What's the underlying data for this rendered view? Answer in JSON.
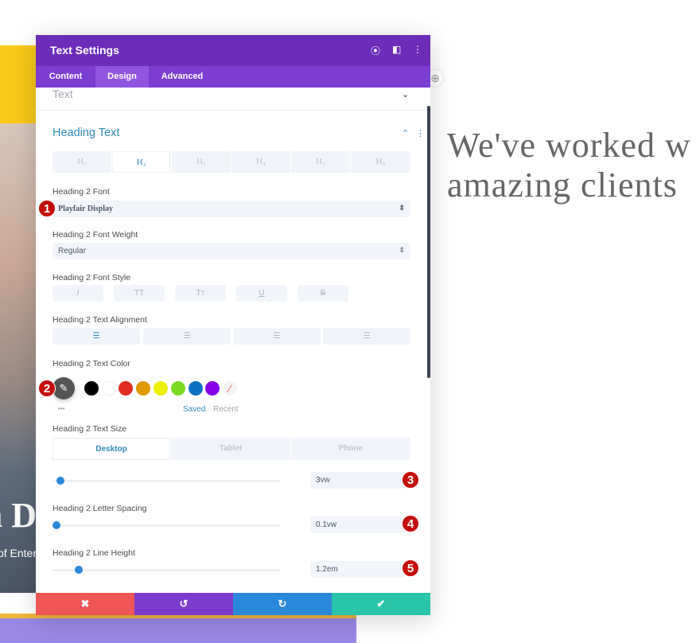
{
  "background": {
    "hero_text": "n D",
    "hero_sub": "of Enter",
    "right_heading": [
      "We've worked w",
      "amazing clients"
    ]
  },
  "panel": {
    "title": "Text Settings",
    "header_icons": [
      "focus-icon",
      "sidebar-toggle-icon",
      "more-vertical-icon"
    ],
    "tabs": [
      {
        "label": "Content"
      },
      {
        "label": "Design",
        "active": true
      },
      {
        "label": "Advanced"
      }
    ],
    "collapsed_section": "Text",
    "section_title": "Heading Text",
    "heading_tabs": [
      "H₁",
      "H₂",
      "H₃",
      "H₄",
      "H₅",
      "H₆"
    ],
    "active_heading_tab": "H₂",
    "font": {
      "label": "Heading 2 Font",
      "value": "Playfair Display"
    },
    "weight": {
      "label": "Heading 2 Font Weight",
      "value": "Regular"
    },
    "style": {
      "label": "Heading 2 Font Style",
      "options": [
        "I",
        "TT",
        "Tт",
        "U",
        "S"
      ]
    },
    "alignment": {
      "label": "Heading 2 Text Alignment",
      "options": [
        "align-left",
        "align-center",
        "align-right",
        "align-justify"
      ],
      "active": "align-left"
    },
    "color": {
      "label": "Heading 2 Text Color",
      "swatches": [
        "#000000",
        "#ffffff",
        "#e02b20",
        "#e09900",
        "#edf000",
        "#7cda24",
        "#0c71c3",
        "#8300e9"
      ],
      "saved": "Saved",
      "recent": "Recent",
      "more": "•••"
    },
    "size": {
      "label": "Heading 2 Text Size",
      "devices": [
        "Desktop",
        "Tablet",
        "Phone"
      ],
      "active_device": "Desktop",
      "value": "3vw",
      "slider_fraction": 0.03
    },
    "letter_spacing": {
      "label": "Heading 2 Letter Spacing",
      "value": "0.1vw",
      "slider_fraction": 0.01
    },
    "line_height": {
      "label": "Heading 2 Line Height",
      "value": "1.2em",
      "slider_fraction": 0.11
    },
    "footer": {
      "cancel": "✖",
      "undo": "↺",
      "redo": "↻",
      "save": "✔"
    },
    "colors": {
      "header": "#6c2eb9",
      "accent": "#2e8ab8",
      "cancel": "#ef5555",
      "undo": "#7b3cce",
      "redo": "#2b87da",
      "save": "#29c4a9"
    }
  },
  "badges": [
    "1",
    "2",
    "3",
    "4",
    "5"
  ]
}
